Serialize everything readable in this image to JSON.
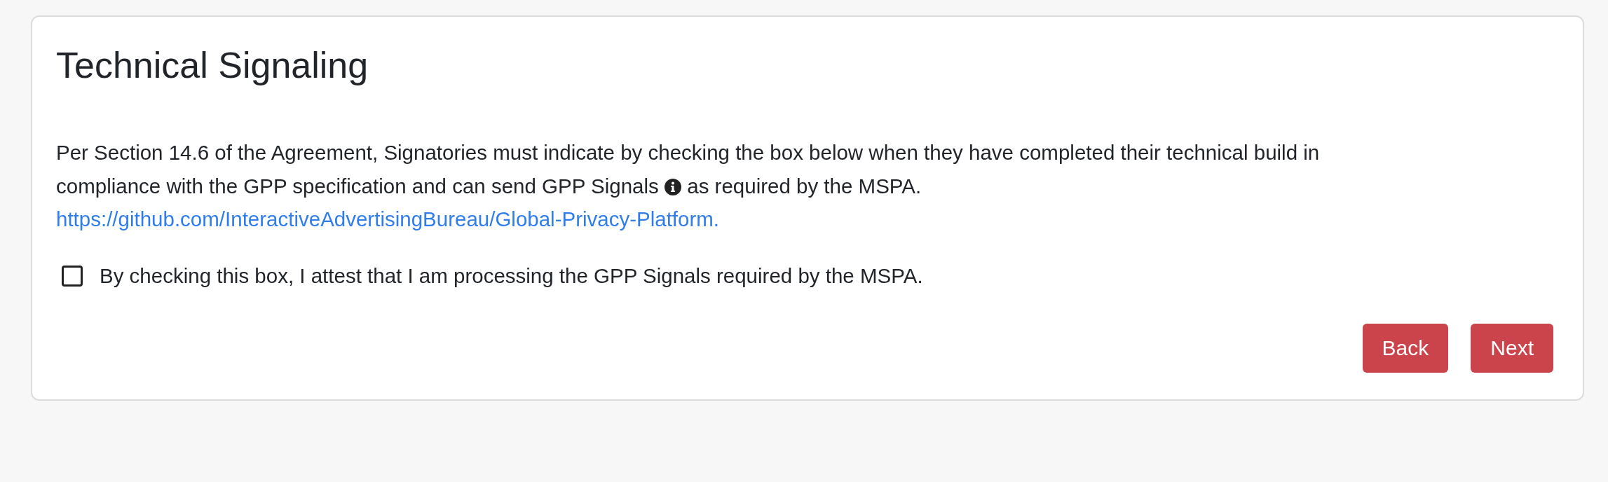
{
  "card": {
    "title": "Technical Signaling",
    "intro_line_1": "Per Section 14.6 of the Agreement, Signatories must indicate by checking the box below when they have completed their technical build in",
    "intro_before_icon": "compliance with the GPP specification and can send GPP Signals",
    "intro_after_icon": "as required by the MSPA.",
    "link": "https://github.com/InteractiveAdvertisingBureau/Global-Privacy-Platform.",
    "attestation": {
      "label": "By checking this box, I attest that I am processing the GPP Signals required by the MSPA.",
      "checked": false
    },
    "buttons": [
      {
        "label": "Back"
      },
      {
        "label": "Next"
      }
    ]
  }
}
